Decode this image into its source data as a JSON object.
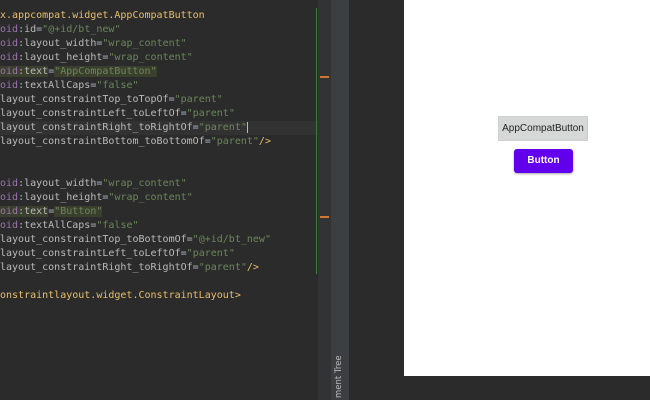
{
  "editor": {
    "lines": [
      {
        "tag": "x.appcompat.widget.AppCompatButton"
      },
      {
        "ns": "oid",
        "attr": "id",
        "value": "@+id/bt_new"
      },
      {
        "ns": "oid",
        "attr": "layout_width",
        "value": "wrap_content"
      },
      {
        "ns": "oid",
        "attr": "layout_height",
        "value": "wrap_content"
      },
      {
        "ns": "oid",
        "attr": "text",
        "value": "AppCompatButton"
      },
      {
        "ns": "oid",
        "attr": "textAllCaps",
        "value": "false"
      },
      {
        "ns": "",
        "attr": "layout_constraintTop_toTopOf",
        "value": "parent"
      },
      {
        "ns": "",
        "attr": "layout_constraintLeft_toLeftOf",
        "value": "parent"
      },
      {
        "ns": "",
        "attr": "layout_constraintRight_toRightOf",
        "value": "parent"
      },
      {
        "ns": "",
        "attr": "layout_constraintBottom_toBottomOf",
        "value": "parent",
        "close": "/>"
      },
      {},
      {},
      {
        "ns": "oid",
        "attr": "layout_width",
        "value": "wrap_content"
      },
      {
        "ns": "oid",
        "attr": "layout_height",
        "value": "wrap_content"
      },
      {
        "ns": "oid",
        "attr": "text",
        "value": "Button"
      },
      {
        "ns": "oid",
        "attr": "textAllCaps",
        "value": "false"
      },
      {
        "ns": "",
        "attr": "layout_constraintTop_toBottomOf",
        "value": "@+id/bt_new"
      },
      {
        "ns": "",
        "attr": "layout_constraintLeft_toLeftOf",
        "value": "parent"
      },
      {
        "ns": "",
        "attr": "layout_constraintRight_toRightOf",
        "value": "parent",
        "close": "/>"
      },
      {},
      {
        "tag": "onstraintlayout.widget.ConstraintLayout",
        "close": ">"
      }
    ]
  },
  "side_panel": {
    "component_tree_label": "ment Tree"
  },
  "preview": {
    "appcompat_button_label": "AppCompatButton",
    "material_button_label": "Button",
    "accent_color": "#6200ee"
  },
  "colors": {
    "tag": "#e8bf6a",
    "attribute": "#bababa",
    "namespace": "#9876aa",
    "value": "#6a8759",
    "fold_marker": "#cc7832"
  }
}
